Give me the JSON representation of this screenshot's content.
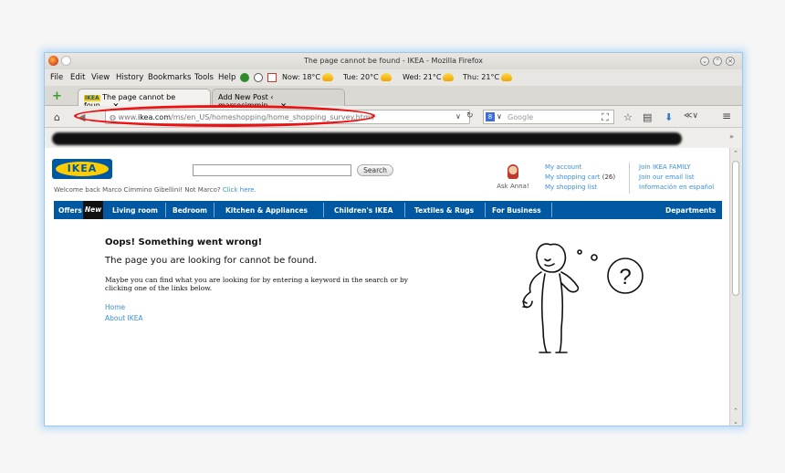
{
  "window": {
    "title": "The page cannot be found - IKEA - Mozilla Firefox"
  },
  "menu": [
    {
      "label": "File"
    },
    {
      "label": "Edit"
    },
    {
      "label": "View"
    },
    {
      "label": "History"
    },
    {
      "label": "Bookmarks"
    },
    {
      "label": "Tools"
    },
    {
      "label": "Help"
    }
  ],
  "weather": [
    {
      "label": "Now: 18°C"
    },
    {
      "label": "Tue: 20°C"
    },
    {
      "label": "Wed: 21°C"
    },
    {
      "label": "Thu: 21°C"
    }
  ],
  "tabs": [
    {
      "label": "The page cannot be foun...",
      "close": "×"
    },
    {
      "label": "Add New Post ‹ marcocimmin...",
      "close": "×"
    }
  ],
  "navbar": {
    "url_prefix": "www.",
    "url_domain": "ikea.com",
    "url_path": "/ms/en_US/homeshopping/home_shopping_survey.html/",
    "search_placeholder": "Google",
    "search_engine_badge": "8"
  },
  "site": {
    "logo_text": "IKEA",
    "search_button": "Search",
    "welcome_text": "Welcome back Marco Cimmino Gibellini! Not Marco?",
    "welcome_link": "Click here.",
    "ask_anna": "Ask Anna!",
    "account_links": [
      "My account",
      "My shopping cart",
      "My shopping list"
    ],
    "cart_count": "(26)",
    "family_links": [
      "Join IKEA FAMILY",
      "Join our email list",
      "Información en español"
    ],
    "nav": {
      "offers": "Offers",
      "new": "New",
      "items": [
        "Living room",
        "Bedroom",
        "Kitchen & Appliances",
        "Children's IKEA",
        "Textiles & Rugs",
        "For Business"
      ],
      "departments": "Departments"
    },
    "error": {
      "title": "Oops! Something went wrong!",
      "message": "The page you are looking for cannot be found.",
      "description": "Maybe you can find what you are looking for by entering a keyword in the search or by clicking one of the links below.",
      "links": [
        "Home",
        "About IKEA"
      ],
      "question_mark": "?"
    }
  },
  "colors": {
    "ikea_blue": "#0058a3",
    "ikea_yellow": "#ffcc00",
    "link": "#3a8fd8",
    "annotation_red": "#ee1111"
  }
}
